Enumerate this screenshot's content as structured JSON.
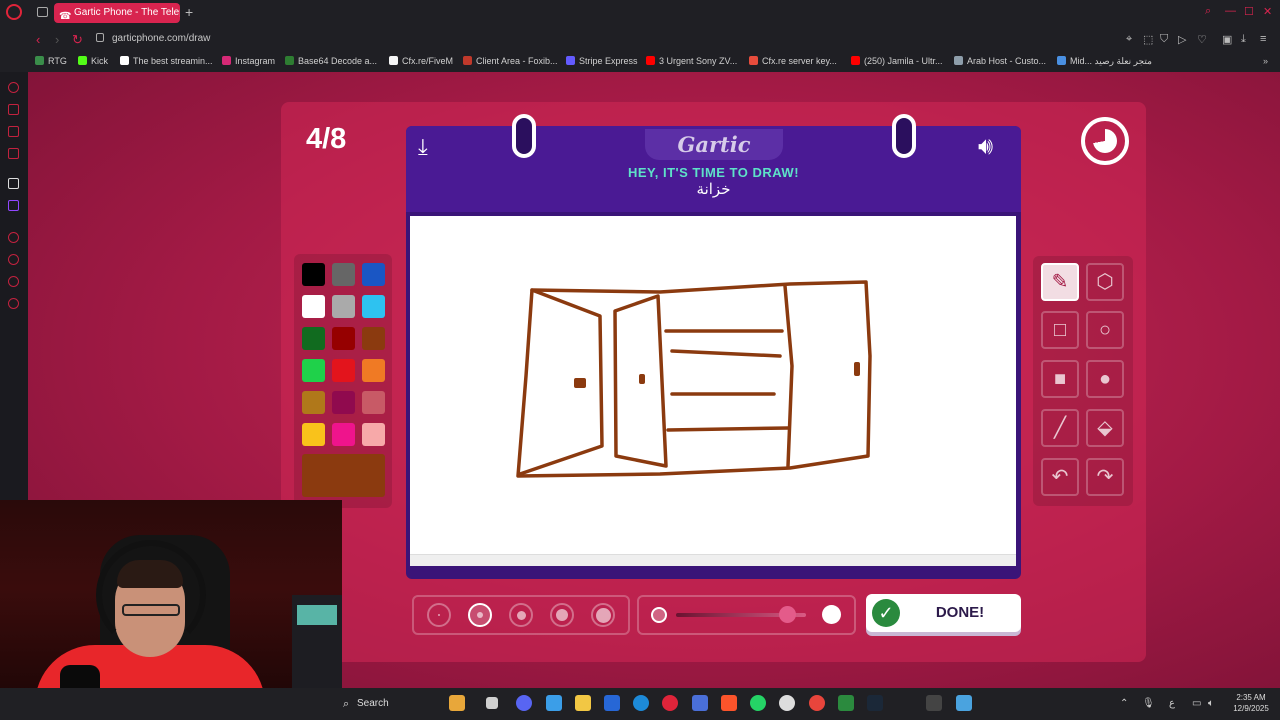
{
  "browser": {
    "tab_title": "Gartic Phone - The Teleph",
    "new_tab": "+",
    "url": "garticphone.com/draw",
    "bookmarks": [
      {
        "label": "RTG",
        "color": "#3a8d4a"
      },
      {
        "label": "Kick",
        "color": "#53fc18"
      },
      {
        "label": "The best streamin...",
        "color": "#ffffff"
      },
      {
        "label": "Instagram",
        "color": "#d62976"
      },
      {
        "label": "Base64 Decode a...",
        "color": "#2e7d32"
      },
      {
        "label": "Cfx.re/FiveM",
        "color": "#f5f5f5"
      },
      {
        "label": "Client Area - Foxib...",
        "color": "#c0392b"
      },
      {
        "label": "Stripe Express",
        "color": "#635bff"
      },
      {
        "label": "3 Urgent Sony ZV...",
        "color": "#ff0000"
      },
      {
        "label": "Cfx.re server key...",
        "color": "#e74c3c"
      },
      {
        "label": "(250) Jamila - Ultr...",
        "color": "#ff0000"
      },
      {
        "label": "Arab Host - Custo...",
        "color": "#8e9eab"
      },
      {
        "label": "Mid... متجر نعلة رصيد",
        "color": "#4a90e2"
      }
    ]
  },
  "game": {
    "round": "4/8",
    "logo": "Gartic",
    "prompt_line1": "HEY, IT'S TIME TO DRAW!",
    "prompt_line2": "خزانة",
    "done_label": "DONE!",
    "selected_color": "#8b3a0f",
    "palette": [
      "#000000",
      "#666666",
      "#1a56c4",
      "#ffffff",
      "#aaaaaa",
      "#2ec2f0",
      "#116b1f",
      "#960000",
      "#8b3a0f",
      "#1fd14a",
      "#e3141c",
      "#f07a24",
      "#b0781a",
      "#900a4e",
      "#c85a66",
      "#f9c21b",
      "#ef148c",
      "#f7a9a9"
    ],
    "tools": [
      "pencil-icon",
      "eraser-icon",
      "rectangle-outline-icon",
      "circle-outline-icon",
      "rectangle-fill-icon",
      "circle-fill-icon",
      "line-icon",
      "fill-bucket-icon",
      "undo-icon",
      "redo-icon"
    ],
    "brush_sizes": [
      2,
      6,
      9,
      12,
      15
    ],
    "selected_brush": 1,
    "opacity": 0.85
  },
  "taskbar": {
    "search_label": "Search",
    "time": "2:35 AM",
    "date": "12/9/2025",
    "lang": "ع"
  }
}
